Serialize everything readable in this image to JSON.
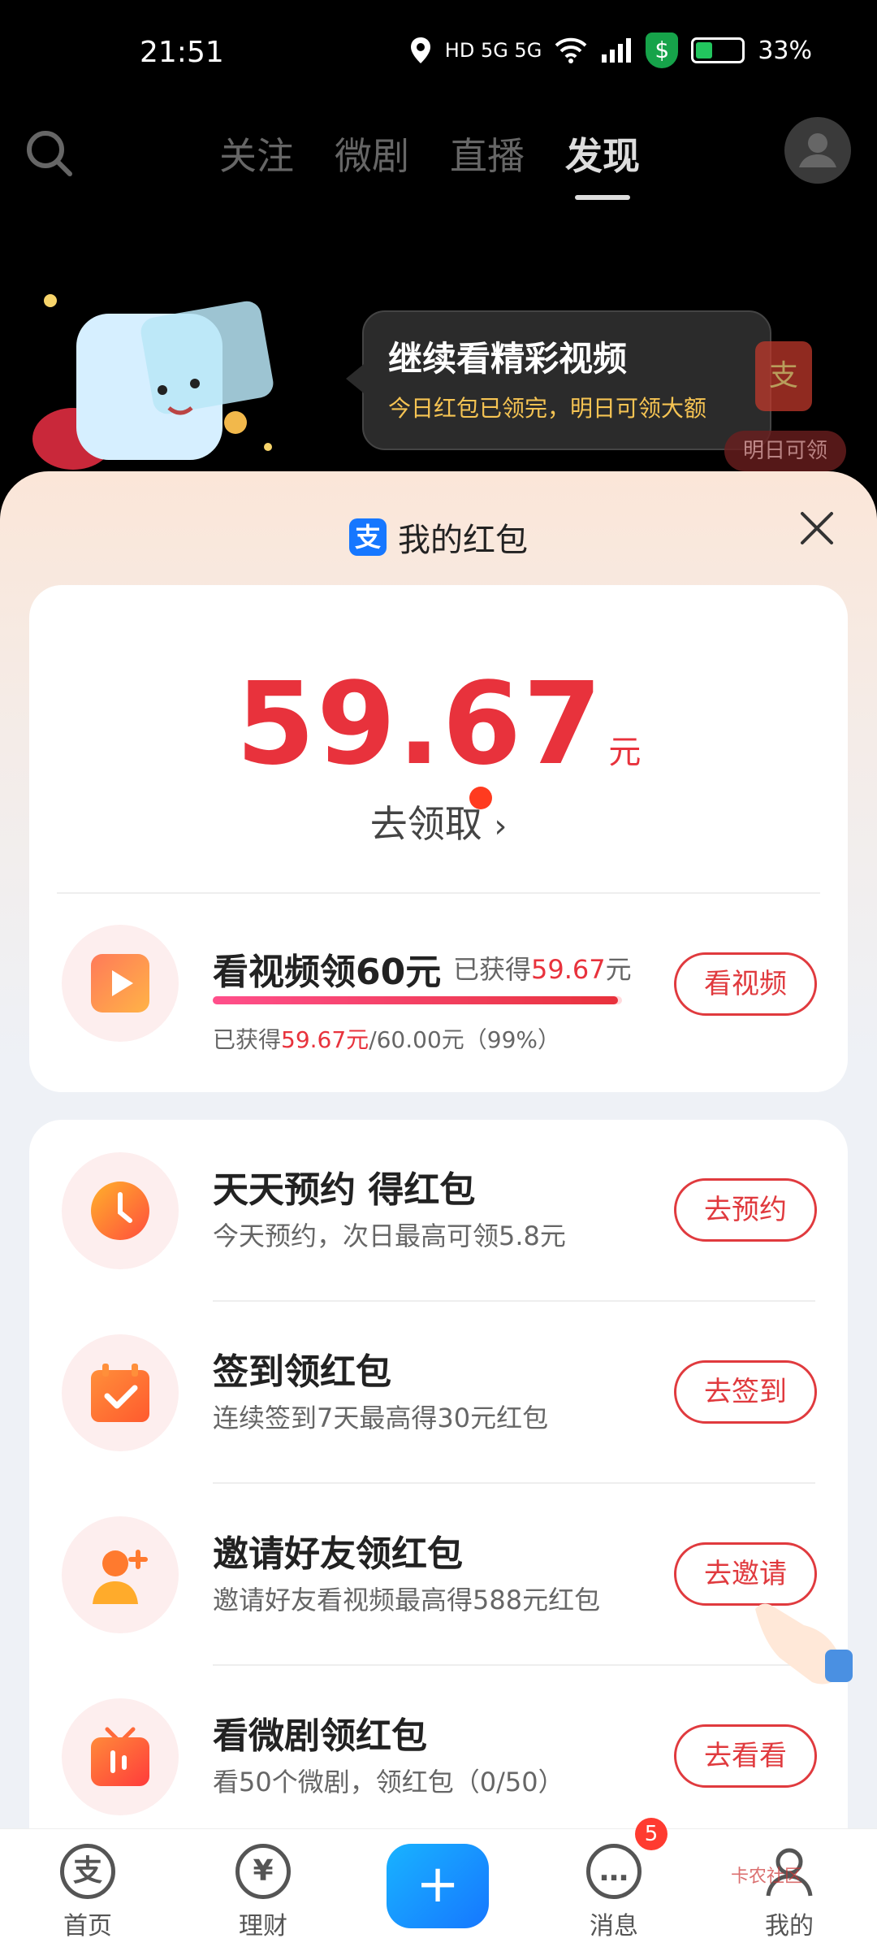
{
  "status_bar": {
    "time": "21:51",
    "network": "HD 5G 5G",
    "battery": "33%"
  },
  "top_nav": {
    "tabs": [
      "关注",
      "微剧",
      "直播",
      "发现"
    ],
    "active_tab": "发现"
  },
  "banner": {
    "bubble_title": "继续看精彩视频",
    "bubble_subtitle": "今日红包已领完，明日可领大额",
    "packet_char": "支",
    "tomorrow_label": "明日可领"
  },
  "sheet": {
    "logo_char": "支",
    "title": "我的红包",
    "amount": "59.67",
    "amount_unit": "元",
    "collect_label": "去领取",
    "video_task": {
      "title": "看视频领60元",
      "earned_prefix": "已获得",
      "earned_value": "59.67",
      "earned_unit": "元",
      "progress_prefix": "已获得",
      "progress_value": "59.67元",
      "progress_suffix": "/60.00元（99%）",
      "progress_fraction": 0.99,
      "button": "看视频"
    },
    "tasks": [
      {
        "title": "天天预约 得红包",
        "subtitle": "今天预约，次日最高可领5.8元",
        "button": "去预约",
        "icon": "clock-icon"
      },
      {
        "title": "签到领红包",
        "subtitle": "连续签到7天最高得30元红包",
        "button": "去签到",
        "icon": "calendar-check-icon"
      },
      {
        "title": "邀请好友领红包",
        "subtitle": "邀请好友看视频最高得588元红包",
        "button": "去邀请",
        "icon": "add-user-icon"
      },
      {
        "title": "看微剧领红包",
        "subtitle": "看50个微剧，领红包（0/50）",
        "button": "去看看",
        "icon": "tv-icon"
      }
    ]
  },
  "bottom_nav": {
    "items": [
      {
        "label": "首页",
        "glyph": "支"
      },
      {
        "label": "理财",
        "glyph": "¥"
      },
      {
        "label": "消息",
        "glyph": "…"
      },
      {
        "label": "我的",
        "glyph": ""
      }
    ],
    "plus_glyph": "+",
    "message_badge": "5"
  },
  "watermark": "卡农社区",
  "colors": {
    "accent_red": "#e8323c",
    "brand_blue": "#1677ff",
    "progress_pink": "#ff4f8b"
  }
}
